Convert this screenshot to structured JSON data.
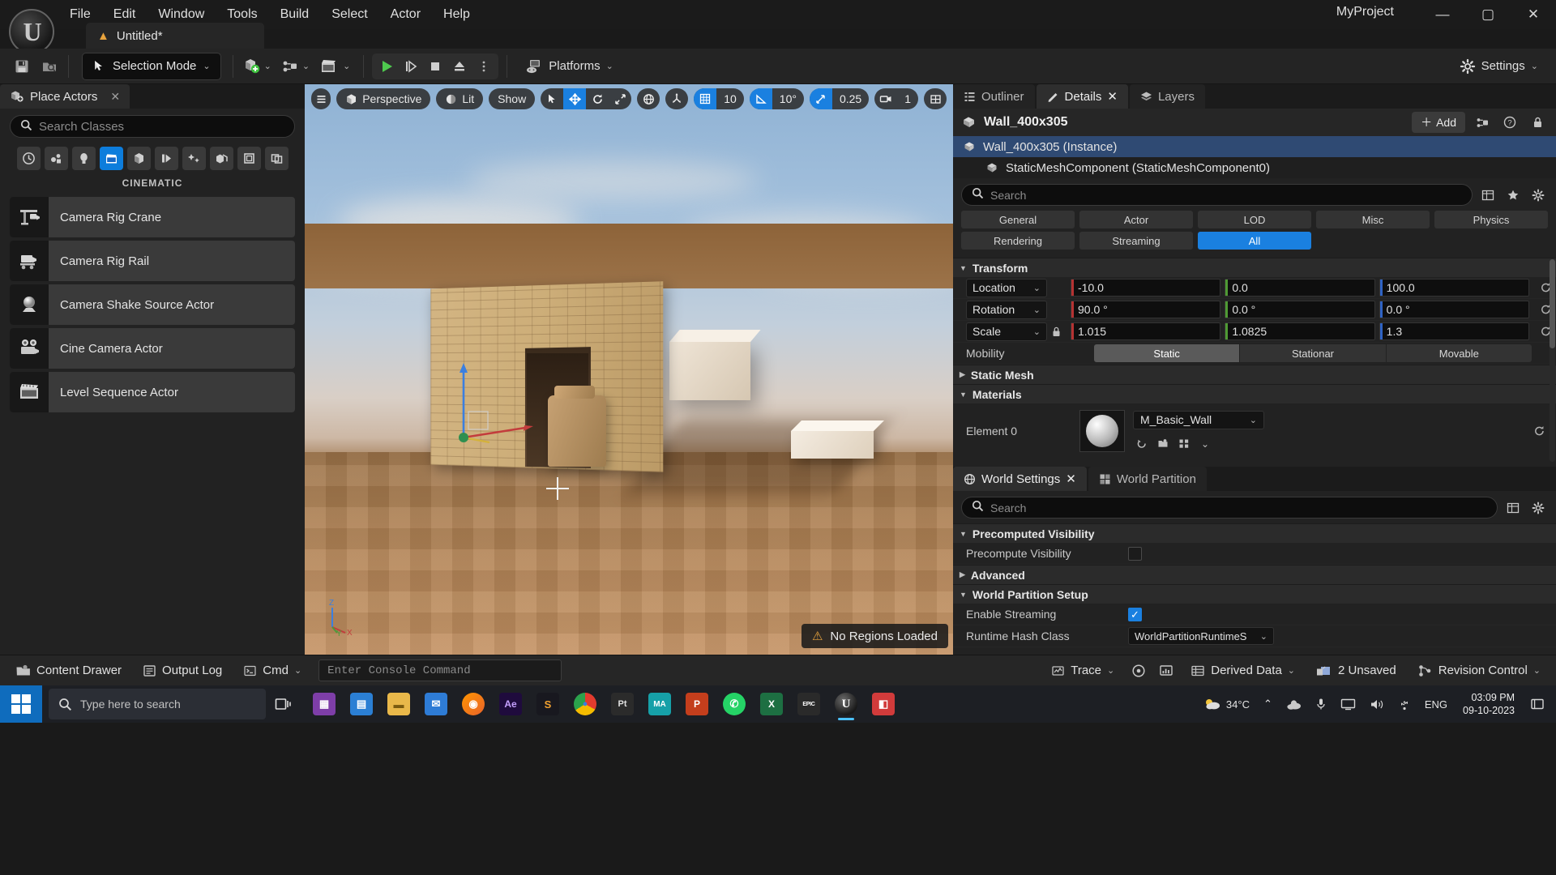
{
  "window": {
    "project_name": "MyProject",
    "minimize": "—",
    "maximize": "▢",
    "close": "✕"
  },
  "menubar": {
    "items": [
      {
        "label": "File"
      },
      {
        "label": "Edit"
      },
      {
        "label": "Window"
      },
      {
        "label": "Tools"
      },
      {
        "label": "Build"
      },
      {
        "label": "Select"
      },
      {
        "label": "Actor"
      },
      {
        "label": "Help"
      }
    ]
  },
  "level_tab": {
    "label": "Untitled*",
    "icon": "warning-triangle-icon"
  },
  "toolbar": {
    "save_icon": "save-icon",
    "browse_icon": "browse-content-icon",
    "mode_label": "Selection Mode",
    "add_icon": "add-actor-icon",
    "blueprint_icon": "blueprints-icon",
    "cinematics_icon": "cinematics-icon",
    "play_icon": "play-icon",
    "skip_icon": "step-forward-icon",
    "stop_icon": "stop-icon",
    "eject_icon": "eject-icon",
    "more_icon": "more-options-icon",
    "platforms_label": "Platforms",
    "settings_label": "Settings"
  },
  "place_actors": {
    "tab_label": "Place Actors",
    "close": "✕",
    "search_placeholder": "Search Classes",
    "search_value": "",
    "categories": [
      {
        "name": "recently-placed-icon",
        "active": false
      },
      {
        "name": "basic-shapes-icon",
        "active": false
      },
      {
        "name": "lights-icon",
        "active": false
      },
      {
        "name": "cinematic-icon",
        "active": true
      },
      {
        "name": "geometry-icon",
        "active": false
      },
      {
        "name": "visual-effects-icon",
        "active": false
      },
      {
        "name": "effects-icon",
        "active": false
      },
      {
        "name": "volumes-icon",
        "active": false
      },
      {
        "name": "all-classes-icon",
        "active": false
      },
      {
        "name": "shapes-icon",
        "active": false
      }
    ],
    "section_title": "CINEMATIC",
    "actors": [
      {
        "label": "Camera Rig Crane",
        "icon": "camera-rig-crane-icon"
      },
      {
        "label": "Camera Rig Rail",
        "icon": "camera-rig-rail-icon"
      },
      {
        "label": "Camera Shake Source Actor",
        "icon": "camera-shake-source-icon"
      },
      {
        "label": "Cine Camera Actor",
        "icon": "cine-camera-icon"
      },
      {
        "label": "Level Sequence Actor",
        "icon": "level-sequence-icon"
      }
    ]
  },
  "viewport": {
    "menu_icon": "viewport-menu-icon",
    "perspective_label": "Perspective",
    "lit_label": "Lit",
    "show_label": "Show",
    "transform_tools": [
      {
        "name": "select-tool-icon",
        "glyph": "➤",
        "active": false
      },
      {
        "name": "move-tool-icon",
        "glyph": "✥",
        "active": true
      },
      {
        "name": "rotate-tool-icon",
        "glyph": "⟳",
        "active": false
      },
      {
        "name": "scale-tool-icon",
        "glyph": "⤢",
        "active": false
      }
    ],
    "world_coord_icon": "world-coordinate-icon",
    "surface_snap_icon": "surface-snap-icon",
    "grid_snap": {
      "icon": "grid-snap-icon",
      "value": "10",
      "active": true
    },
    "angle_snap": {
      "icon": "angle-snap-icon",
      "value": "10°",
      "active": true
    },
    "scale_snap": {
      "icon": "scale-snap-icon",
      "value": "0.25",
      "active": true
    },
    "camera_speed": {
      "icon": "camera-speed-icon",
      "value": "1"
    },
    "layout_icon": "viewport-layout-icon",
    "warning_banner": "No Regions Loaded",
    "warning_icon": "warning-triangle-icon",
    "axis_labels": {
      "z": "Z",
      "y": "Y",
      "x": "X"
    }
  },
  "outliner": {
    "tabs": [
      {
        "label": "Outliner",
        "icon": "outliner-icon",
        "active": false,
        "closable": false
      },
      {
        "label": "Details",
        "icon": "details-icon",
        "active": true,
        "closable": true
      },
      {
        "label": "Layers",
        "icon": "layers-icon",
        "active": false,
        "closable": false
      }
    ],
    "header_title": "Wall_400x305",
    "header_icon": "static-mesh-icon",
    "add_label": "Add",
    "header_icons": [
      "blueprint-icon",
      "help-icon",
      "lock-icon"
    ],
    "rows": [
      {
        "label": "Wall_400x305 (Instance)",
        "icon": "static-mesh-icon",
        "selected": true,
        "child": false
      },
      {
        "label": "StaticMeshComponent (StaticMeshComponent0)",
        "icon": "static-mesh-component-icon",
        "selected": false,
        "child": true
      }
    ]
  },
  "details": {
    "search_placeholder": "Search",
    "search_value": "",
    "toolbar_icons": [
      "column-view-icon",
      "favorites-star-icon",
      "settings-gear-icon"
    ],
    "filters_row1": [
      {
        "label": "General",
        "active": false
      },
      {
        "label": "Actor",
        "active": false
      },
      {
        "label": "LOD",
        "active": false
      },
      {
        "label": "Misc",
        "active": false
      },
      {
        "label": "Physics",
        "active": false
      }
    ],
    "filters_row2": [
      {
        "label": "Rendering",
        "active": false
      },
      {
        "label": "Streaming",
        "active": false
      },
      {
        "label": "All",
        "active": true
      }
    ],
    "transform": {
      "title": "Transform",
      "location": {
        "label": "Location",
        "x": "-10.0",
        "y": "0.0",
        "z": "100.0"
      },
      "rotation": {
        "label": "Rotation",
        "x": "90.0 °",
        "y": "0.0 °",
        "z": "0.0 °"
      },
      "scale": {
        "label": "Scale",
        "x": "1.015",
        "y": "1.0825",
        "z": "1.3",
        "lock_icon": "lock-icon"
      },
      "mobility": {
        "label": "Mobility",
        "options": [
          {
            "label": "Static",
            "active": true
          },
          {
            "label": "Stationar",
            "active": false
          },
          {
            "label": "Movable",
            "active": false
          }
        ]
      },
      "reset_icon": "reset-to-default-icon"
    },
    "static_mesh_section": "Static Mesh",
    "materials": {
      "title": "Materials",
      "element_label": "Element 0",
      "material_name": "M_Basic_Wall",
      "thumb_icon": "material-sphere-icon",
      "tool_icons": [
        "browse-icon",
        "use-selected-icon",
        "edit-icon",
        "more-icon"
      ]
    }
  },
  "world_settings": {
    "tabs": [
      {
        "label": "World Settings",
        "icon": "world-settings-icon",
        "active": true,
        "closable": true
      },
      {
        "label": "World Partition",
        "icon": "world-partition-icon",
        "active": false,
        "closable": false
      }
    ],
    "search_placeholder": "Search",
    "search_value": "",
    "toolbar_icons": [
      "column-view-icon",
      "settings-gear-icon"
    ],
    "sections": [
      {
        "title": "Precomputed Visibility",
        "rows": [
          {
            "label": "Precompute Visibility",
            "type": "checkbox",
            "checked": false
          }
        ]
      },
      {
        "title": "Advanced",
        "collapsed": true,
        "rows": []
      },
      {
        "title": "World Partition Setup",
        "rows": [
          {
            "label": "Enable Streaming",
            "type": "checkbox",
            "checked": true
          },
          {
            "label": "Runtime Hash Class",
            "type": "select",
            "value": "WorldPartitionRuntimeS"
          }
        ]
      }
    ]
  },
  "statusbar": {
    "left_buttons": [
      {
        "label": "Content Drawer",
        "icon": "content-drawer-icon"
      },
      {
        "label": "Output Log",
        "icon": "output-log-icon"
      },
      {
        "label": "Cmd",
        "icon": "cmd-icon",
        "has_caret": true
      }
    ],
    "console_placeholder": "Enter Console Command",
    "console_value": "",
    "right_buttons": [
      {
        "label": "Trace",
        "icon": "trace-icon",
        "has_caret": true
      },
      {
        "label": "",
        "icon": "unreal-insights-icon"
      },
      {
        "label": "",
        "icon": "performance-icon"
      },
      {
        "label": "Derived Data",
        "icon": "derived-data-icon",
        "has_caret": true
      },
      {
        "label": "2 Unsaved",
        "icon": "unsaved-changes-icon"
      },
      {
        "label": "Revision Control",
        "icon": "revision-control-icon",
        "has_caret": true
      }
    ]
  },
  "taskbar": {
    "start_icon": "windows-start-icon",
    "search_placeholder": "Type here to search",
    "task_view_icon": "task-view-icon",
    "apps": [
      {
        "name": "xbox-game-bar-icon",
        "label": "",
        "color": "#7e3ea8",
        "glyph": "▦",
        "active": false
      },
      {
        "name": "microsoft-store-icon",
        "label": "",
        "color": "#2b7fd4",
        "glyph": "▤",
        "active": false
      },
      {
        "name": "file-explorer-icon",
        "label": "",
        "color": "#e9b84a",
        "glyph": "🗀",
        "active": false
      },
      {
        "name": "mail-icon",
        "label": "",
        "color": "#2e7cd6",
        "glyph": "✉",
        "active": false
      },
      {
        "name": "firefox-icon",
        "label": "",
        "color": "#e8622a",
        "glyph": "◉",
        "active": false
      },
      {
        "name": "after-effects-icon",
        "label": "Ae",
        "color": "#1f0b3d",
        "glyph": "Ae",
        "active": false
      },
      {
        "name": "substance-icon",
        "label": "S",
        "color": "#18181f",
        "glyph": "S",
        "active": false
      },
      {
        "name": "chrome-icon",
        "label": "",
        "color": "#f2f2f2",
        "glyph": "◍",
        "active": false
      },
      {
        "name": "pt-run-icon",
        "label": "Pt",
        "color": "#2b2b2b",
        "glyph": "Pt",
        "active": false
      },
      {
        "name": "maya-icon",
        "label": "MA",
        "color": "#16a0a8",
        "glyph": "MA",
        "active": false
      },
      {
        "name": "powerpoint-icon",
        "label": "P",
        "color": "#c43e1c",
        "glyph": "P",
        "active": false
      },
      {
        "name": "whatsapp-icon",
        "label": "",
        "color": "#25d366",
        "glyph": "✆",
        "active": false
      },
      {
        "name": "excel-icon",
        "label": "X",
        "color": "#1d6f42",
        "glyph": "X",
        "active": false
      },
      {
        "name": "epic-games-icon",
        "label": "EPIC",
        "color": "#2a2a2a",
        "glyph": "EPIC",
        "active": false
      },
      {
        "name": "unreal-engine-icon",
        "label": "U",
        "color": "#3a3a3a",
        "glyph": "U",
        "active": true
      },
      {
        "name": "app-red-icon",
        "label": "",
        "color": "#d13b3b",
        "glyph": "◧",
        "active": false
      }
    ],
    "weather": {
      "icon": "weather-cloud-icon",
      "value": "34°C"
    },
    "tray_icons": [
      "chevron-up-icon",
      "onedrive-icon",
      "microphone-icon",
      "display-icon",
      "volume-icon",
      "usb-icon"
    ],
    "language": "ENG",
    "time": "03:09 PM",
    "date": "09-10-2023",
    "notification_icon": "notification-center-icon"
  }
}
